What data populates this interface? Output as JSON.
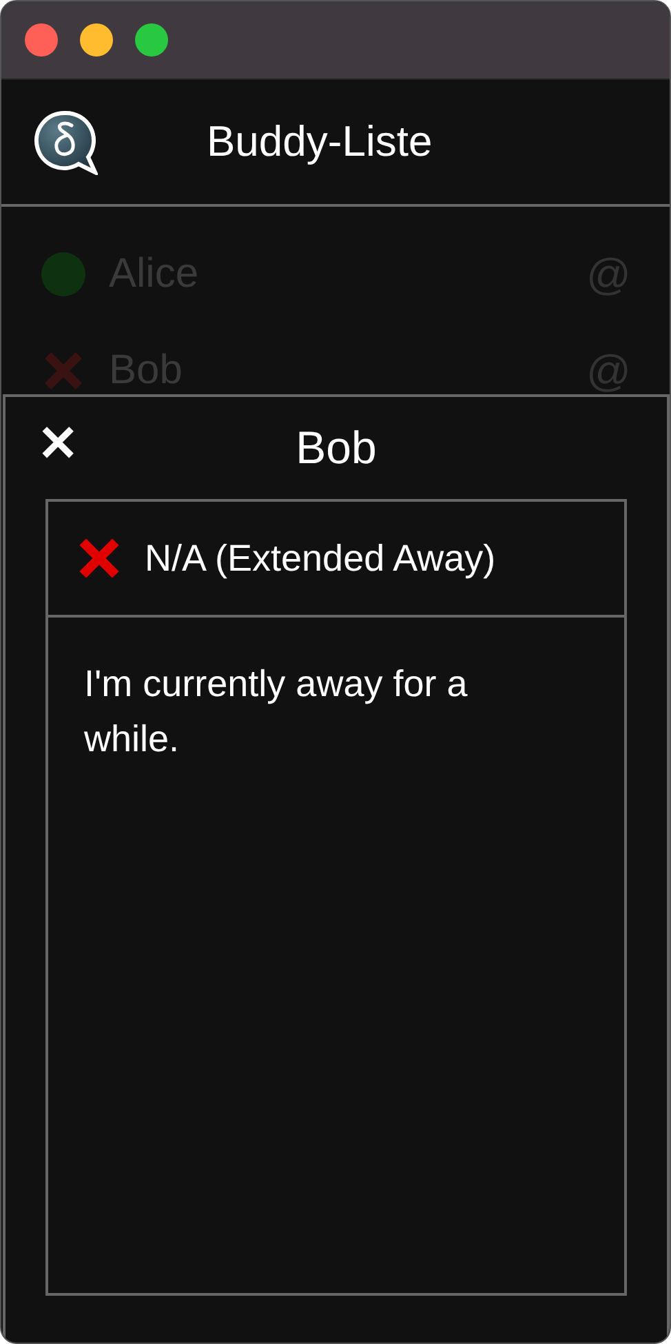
{
  "window": {
    "title": "Buddy-Liste"
  },
  "buddies": [
    {
      "name": "Alice",
      "kind": "online",
      "address_icon": "@"
    },
    {
      "name": "Bob",
      "kind": "xa",
      "address_icon": "@"
    }
  ],
  "detail": {
    "close": "✕",
    "name": "Bob",
    "kind": "xa",
    "status_label": "N/A (Extended Away)",
    "message": "I'm currently away for a while."
  }
}
